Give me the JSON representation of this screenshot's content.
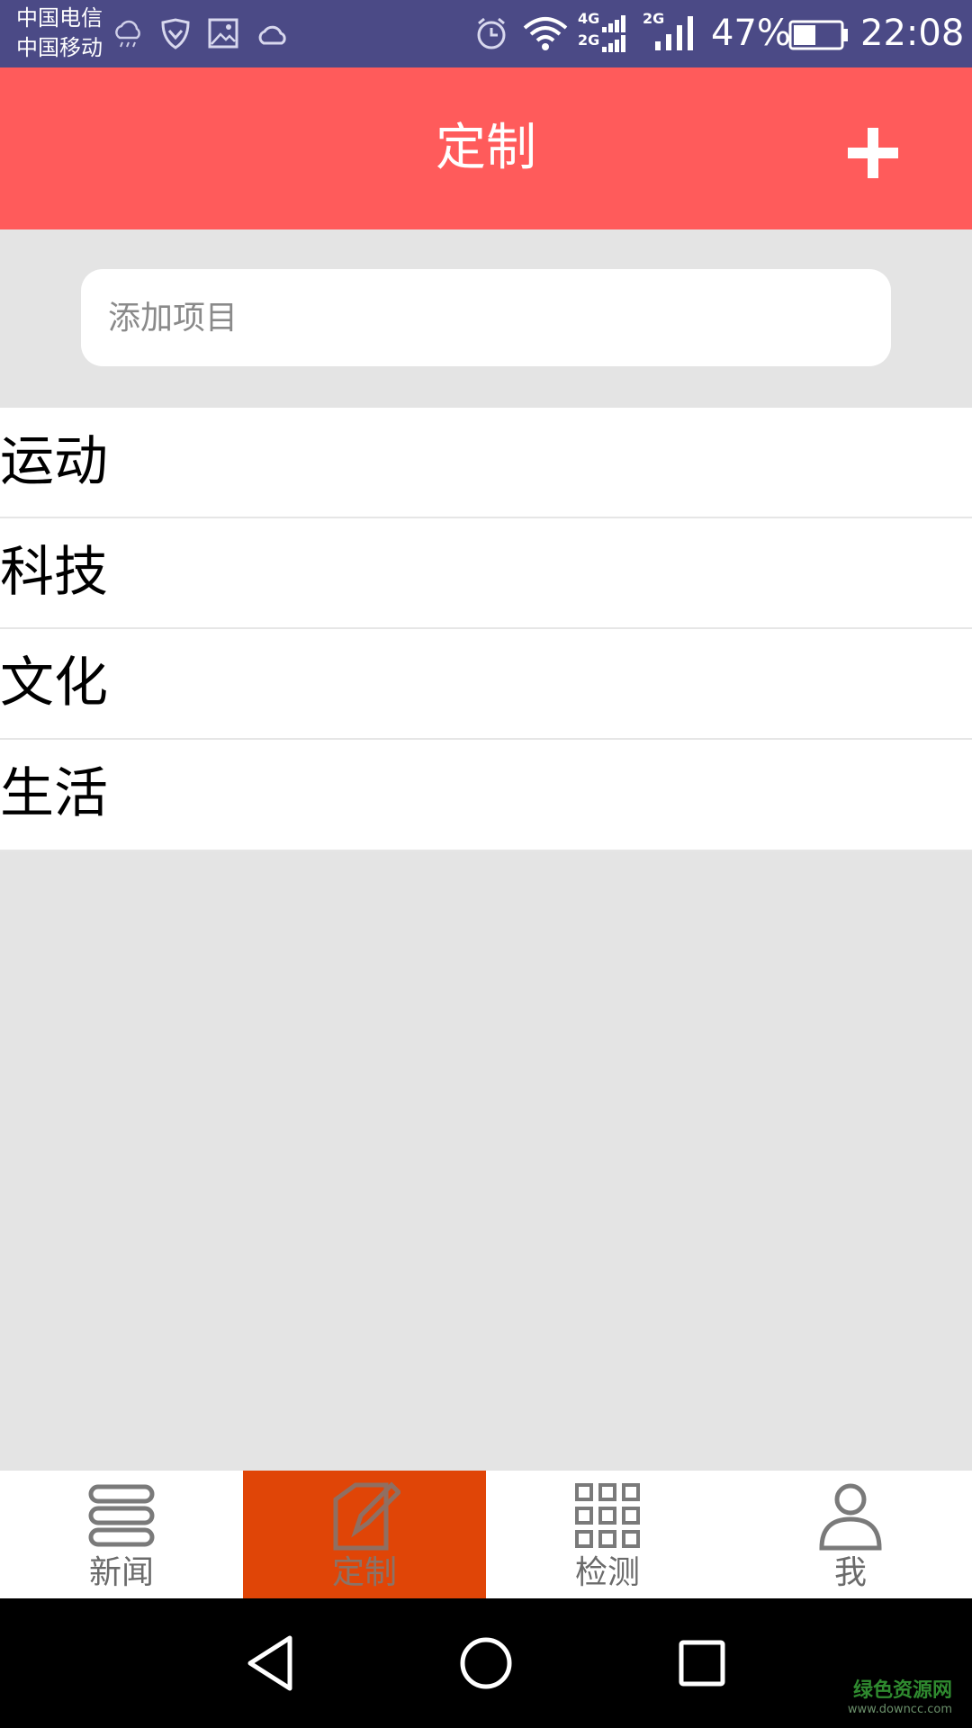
{
  "status_bar": {
    "carrier_1": "中国电信",
    "carrier_2": "中国移动",
    "net_4g": "4G",
    "net_2g_a": "2G",
    "net_2g_b": "2G",
    "battery_percent": "47%",
    "battery_level": 0.47,
    "time": "22:08"
  },
  "header": {
    "title": "定制",
    "add_icon": "plus-icon"
  },
  "search": {
    "placeholder": "添加项目",
    "value": ""
  },
  "categories": [
    {
      "label": "运动"
    },
    {
      "label": "科技"
    },
    {
      "label": "文化"
    },
    {
      "label": "生活"
    }
  ],
  "bottom_nav": {
    "tabs": [
      {
        "label": "新闻",
        "icon": "list-icon",
        "active": false
      },
      {
        "label": "定制",
        "icon": "edit-icon",
        "active": true
      },
      {
        "label": "检测",
        "icon": "grid-icon",
        "active": false
      },
      {
        "label": "我",
        "icon": "person-icon",
        "active": false
      }
    ]
  },
  "watermark": {
    "main": "绿色资源网",
    "sub": "www.downcc.com"
  },
  "colors": {
    "status_bar": "#4b4a86",
    "header": "#ff5b5b",
    "active_tab": "#e04507",
    "background": "#e4e4e4"
  }
}
